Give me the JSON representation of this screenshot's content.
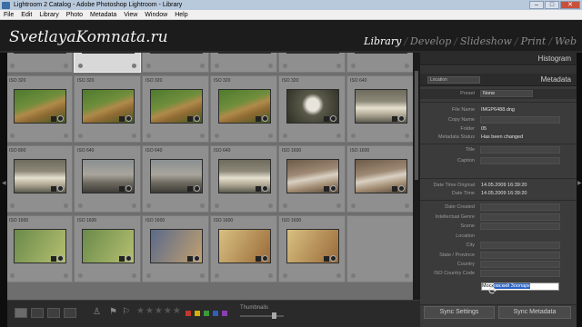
{
  "window": {
    "title": "Lightroom 2 Catalog - Adobe Photoshop Lightroom - Library",
    "minimize": "–",
    "maximize": "□",
    "close": "✕"
  },
  "menu": [
    "File",
    "Edit",
    "Library",
    "Photo",
    "Metadata",
    "View",
    "Window",
    "Help"
  ],
  "header": {
    "brand": "SvetlayaKomnata.ru",
    "modules": [
      "Library",
      "Develop",
      "Slideshow",
      "Print",
      "Web"
    ],
    "active_module": "Library"
  },
  "grid": {
    "cells": [
      {
        "iso": "ISO 400",
        "image": "wolf"
      },
      {
        "iso": "ISO 200",
        "image": "lion",
        "selected": true
      },
      {
        "iso": "ISO 250",
        "image": "cheetah"
      },
      {
        "iso": "ISO 250",
        "image": "cheetah"
      },
      {
        "iso": "ISO 250",
        "image": "cheetah"
      },
      {
        "iso": "ISO 100",
        "image": "cheetah"
      },
      {
        "iso": "ISO 320",
        "image": "cheetah"
      },
      {
        "iso": "ISO 320",
        "image": "cheetah"
      },
      {
        "iso": "ISO 320",
        "image": "cheetah"
      },
      {
        "iso": "ISO 320",
        "image": "cheetah"
      },
      {
        "iso": "ISO 320",
        "image": "owl"
      },
      {
        "iso": "ISO 640",
        "image": "bear"
      },
      {
        "iso": "ISO 800",
        "image": "bear"
      },
      {
        "iso": "ISO 640",
        "image": "rocks"
      },
      {
        "iso": "ISO 640",
        "image": "rocks"
      },
      {
        "iso": "ISO 640",
        "image": "bear"
      },
      {
        "iso": "ISO 1600",
        "image": "goat"
      },
      {
        "iso": "ISO 1600",
        "image": "goat"
      },
      {
        "iso": "ISO 1600",
        "image": "blur1"
      },
      {
        "iso": "ISO 1600",
        "image": "blur1"
      },
      {
        "iso": "ISO 1600",
        "image": "blur2"
      },
      {
        "iso": "ISO 1600",
        "image": "blur3"
      },
      {
        "iso": "ISO 1600",
        "image": "blur3"
      },
      {
        "iso": "",
        "image": "empty"
      }
    ]
  },
  "toolbar": {
    "stars": "★★★★★",
    "thumbnails_label": "Thumbnails",
    "color_labels": [
      "#c0392b",
      "#d4b106",
      "#3c9a3c",
      "#2f5fb8",
      "#8a3fb0"
    ]
  },
  "panel": {
    "histogram_title": "Histogram",
    "metadata_title": "Metadata",
    "metadata_view": "Location",
    "preset_label": "Preset",
    "preset_value": "None",
    "fields": [
      {
        "label": "File Name",
        "value": "IMGP6488.dng"
      },
      {
        "label": "Copy Name",
        "value": ""
      },
      {
        "label": "Folder",
        "value": "05"
      },
      {
        "label": "Metadata Status",
        "value": "Has been changed"
      },
      {
        "label": "Title",
        "value": ""
      },
      {
        "label": "Caption",
        "value": ""
      },
      {
        "label": "Date Time Original",
        "value": "14.05.2009 16:39:20"
      },
      {
        "label": "Date Time",
        "value": "14.05.2009 16:39:20"
      },
      {
        "label": "Date Created",
        "value": ""
      },
      {
        "label": "Intellectual Genre",
        "value": ""
      },
      {
        "label": "Scene",
        "value": ""
      },
      {
        "label": "Location",
        "value": ""
      },
      {
        "label": "City",
        "value": ""
      },
      {
        "label": "State / Province",
        "value": ""
      },
      {
        "label": "Country",
        "value": ""
      },
      {
        "label": "ISO Country Code",
        "value": ""
      }
    ],
    "location_typed": "Моск",
    "location_selected": "овский Зоопарк",
    "sync_settings": "Sync Settings",
    "sync_metadata": "Sync Metadata"
  }
}
